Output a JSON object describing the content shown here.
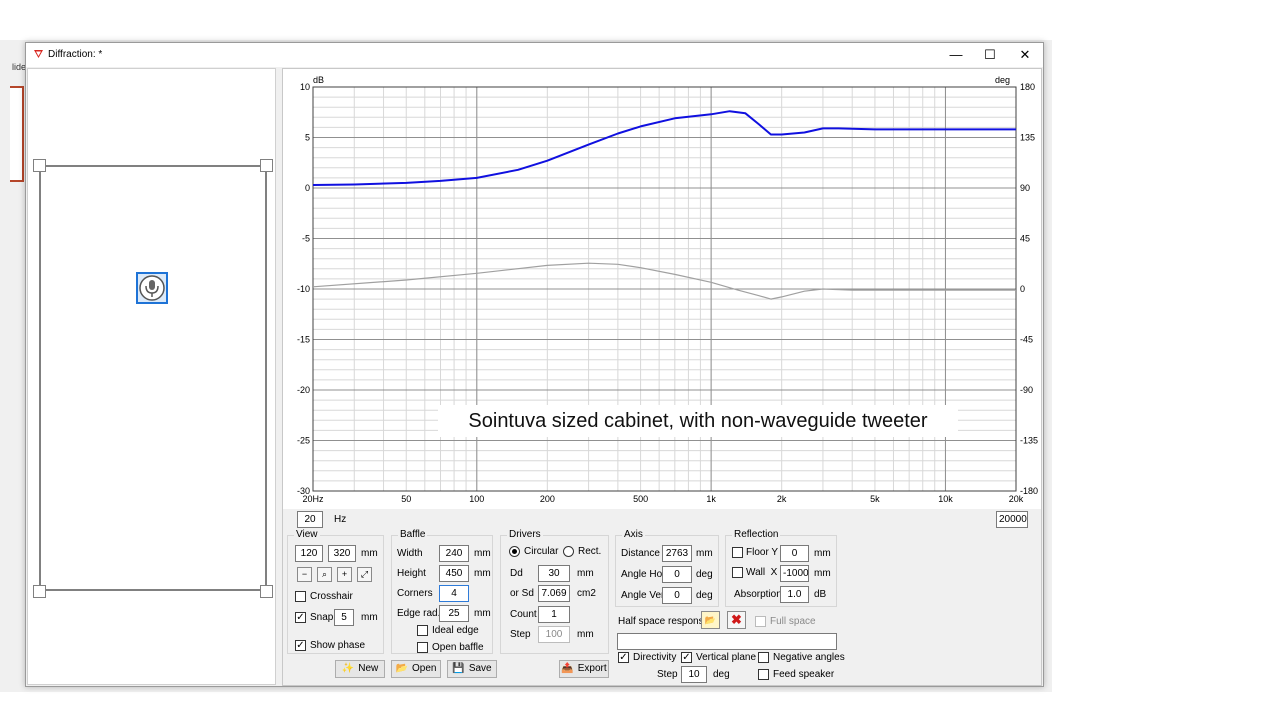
{
  "window": {
    "title": "Diffraction: *",
    "minimize": "—",
    "maximize": "☐",
    "close": "✕"
  },
  "background_app": {
    "snippet": "lide"
  },
  "chart": {
    "left_unit": "dB",
    "right_unit": "deg",
    "annotation": "Sointuva sized cabinet, with non-waveguide tweeter",
    "colors": {
      "magnitude": "#1010e0",
      "phase": "#a0a0a0",
      "grid_major": "#909090",
      "grid_minor": "#d8d8d8"
    }
  },
  "chart_data": {
    "type": "line",
    "x_scale": "log",
    "xlim": [
      20,
      20000
    ],
    "ylim": [
      -30,
      10
    ],
    "y2lim": [
      -180,
      180
    ],
    "x_ticks": [
      "20Hz",
      "50",
      "100",
      "200",
      "500",
      "1k",
      "2k",
      "5k",
      "10k",
      "20k"
    ],
    "x_tick_values": [
      20,
      50,
      100,
      200,
      500,
      1000,
      2000,
      5000,
      10000,
      20000
    ],
    "y_ticks": [
      "10",
      "5",
      "0",
      "-5",
      "-10",
      "-15",
      "-20",
      "-25",
      "-30"
    ],
    "y_tick_values": [
      10,
      5,
      0,
      -5,
      -10,
      -15,
      -20,
      -25,
      -30
    ],
    "y2_ticks": [
      "180",
      "135",
      "90",
      "45",
      "0",
      "-45",
      "-90",
      "-135",
      "-180"
    ],
    "y2_tick_values": [
      180,
      135,
      90,
      45,
      0,
      -45,
      -90,
      -135,
      -180
    ],
    "series": [
      {
        "axis": "left",
        "color": "#1010e0",
        "x": [
          20,
          30,
          50,
          70,
          100,
          150,
          200,
          300,
          400,
          500,
          700,
          1000,
          1200,
          1400,
          1600,
          1800,
          2000,
          2500,
          3000,
          3500,
          5000,
          7000,
          10000,
          15000,
          20000
        ],
        "y": [
          0.3,
          0.35,
          0.5,
          0.7,
          1.0,
          1.8,
          2.7,
          4.3,
          5.4,
          6.1,
          6.9,
          7.3,
          7.6,
          7.4,
          6.3,
          5.3,
          5.3,
          5.5,
          5.9,
          5.9,
          5.8,
          5.8,
          5.8,
          5.8,
          5.8
        ]
      },
      {
        "axis": "right",
        "color": "#a0a0a0",
        "x": [
          20,
          50,
          100,
          200,
          300,
          400,
          500,
          700,
          1000,
          1300,
          1600,
          1800,
          2000,
          2500,
          3000,
          4000,
          6000,
          10000,
          20000
        ],
        "y": [
          2,
          8,
          14,
          21,
          23,
          22,
          19,
          13,
          6,
          -1,
          -6,
          -9,
          -7,
          -2,
          0,
          -1,
          -1,
          -1,
          -1
        ]
      }
    ]
  },
  "range": {
    "min": "20",
    "min_unit": "Hz",
    "max": "20000"
  },
  "view": {
    "title": "View",
    "w": "120",
    "h": "320",
    "unit": "mm",
    "crosshair_label": "Crosshair",
    "crosshair": false,
    "snap_label": "Snap",
    "snap": true,
    "snap_value": "5",
    "snap_unit": "mm",
    "show_phase_label": "Show phase",
    "show_phase": true,
    "zoom_icons": [
      "zoom-out-icon",
      "zoom-in-icon",
      "zoom-in-icon",
      "fit-icon"
    ]
  },
  "baffle": {
    "title": "Baffle",
    "width_label": "Width",
    "width": "240",
    "height_label": "Height",
    "height": "450",
    "corners_label": "Corners",
    "corners": "4",
    "edge_rad_label": "Edge rad.",
    "edge_rad": "25",
    "unit": "mm",
    "ideal_edge_label": "Ideal edge",
    "ideal_edge": false,
    "open_baffle_label": "Open baffle",
    "open_baffle": false
  },
  "drivers": {
    "title": "Drivers",
    "circular_label": "Circular",
    "rect_label": "Rect.",
    "shape": "circular",
    "dd_label": "Dd",
    "dd": "30",
    "dd_unit": "mm",
    "sd_label": "or Sd",
    "sd": "7.069",
    "sd_unit": "cm2",
    "count_label": "Count",
    "count": "1",
    "step_label": "Step",
    "step": "100",
    "step_unit": "mm"
  },
  "axis": {
    "title": "Axis",
    "distance_label": "Distance",
    "distance": "2763",
    "distance_unit": "mm",
    "angle_hor_label": "Angle Hor",
    "angle_hor": "0",
    "angle_ver_label": "Angle Ver",
    "angle_ver": "0",
    "angle_unit": "deg"
  },
  "reflection": {
    "title": "Reflection",
    "floor_label": "Floor Y",
    "floor": false,
    "floor_value": "0",
    "floor_unit": "mm",
    "wall_label": "Wall  X",
    "wall": false,
    "wall_value": "-1000",
    "wall_unit": "mm",
    "absorption_label": "Absorption",
    "absorption": "1.0",
    "absorption_unit": "dB"
  },
  "half_space": {
    "label": "Half space response",
    "full_space_label": "Full space",
    "full_space": false,
    "path": ""
  },
  "options": {
    "directivity_label": "Directivity",
    "directivity": true,
    "vertical_plane_label": "Vertical plane",
    "vertical_plane": true,
    "negative_angles_label": "Negative angles",
    "negative_angles": false,
    "feed_speaker_label": "Feed speaker",
    "feed_speaker": false,
    "step_label": "Step",
    "step": "10",
    "step_unit": "deg"
  },
  "buttons": {
    "new": "New",
    "open": "Open",
    "save": "Save",
    "export": "Export"
  }
}
